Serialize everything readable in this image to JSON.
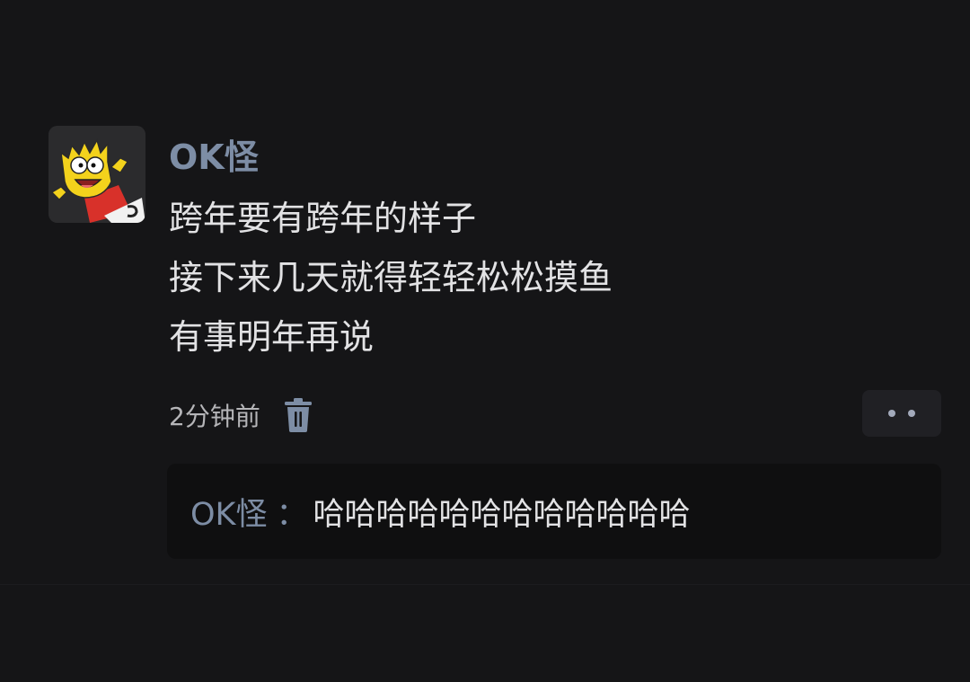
{
  "post": {
    "username": "OK怪",
    "lines": [
      "跨年要有跨年的样子",
      "接下来几天就得轻轻松松摸鱼",
      "有事明年再说"
    ],
    "timestamp": "2分钟前",
    "delete_icon": "trash-icon",
    "more_icon": "ellipsis-icon",
    "avatar_icon": "cartoon-avatar"
  },
  "reply": {
    "author": "OK怪",
    "separator": "：",
    "text": "哈哈哈哈哈哈哈哈哈哈哈哈"
  },
  "colors": {
    "background": "#151517",
    "username": "#7d8da5",
    "text": "#e2e2e4",
    "muted": "#b5b5b8",
    "reply_bg": "#0f0f10"
  }
}
